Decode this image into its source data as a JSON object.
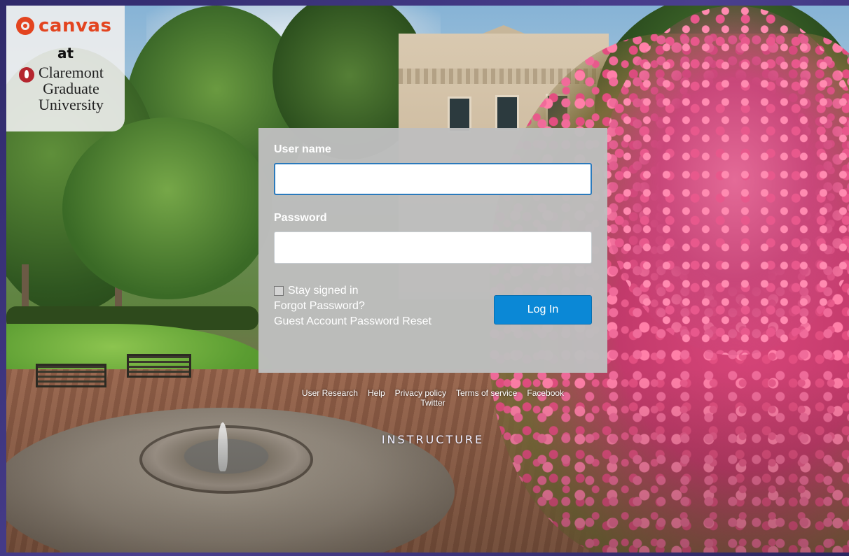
{
  "branding": {
    "canvas_word": "canvas",
    "at_word": "at",
    "school_line1": "Claremont",
    "school_line2": "Graduate",
    "school_line3": "University"
  },
  "login_form": {
    "username_label": "User name",
    "username_value": "",
    "password_label": "Password",
    "password_value": "",
    "stay_signed_in_label": "Stay signed in",
    "stay_signed_in_checked": false,
    "forgot_password_link": "Forgot Password?",
    "guest_reset_link": "Guest Account Password Reset",
    "login_button": "Log In"
  },
  "footer": {
    "links": [
      "User Research",
      "Help",
      "Privacy policy",
      "Terms of service",
      "Facebook",
      "Twitter"
    ],
    "instructure_wordmark": "INSTRUCTURE"
  },
  "colors": {
    "canvas_brand": "#e3441f",
    "cgu_brand": "#b5262f",
    "button_blue": "#0b88d6",
    "focus_border": "#2b7abc"
  }
}
